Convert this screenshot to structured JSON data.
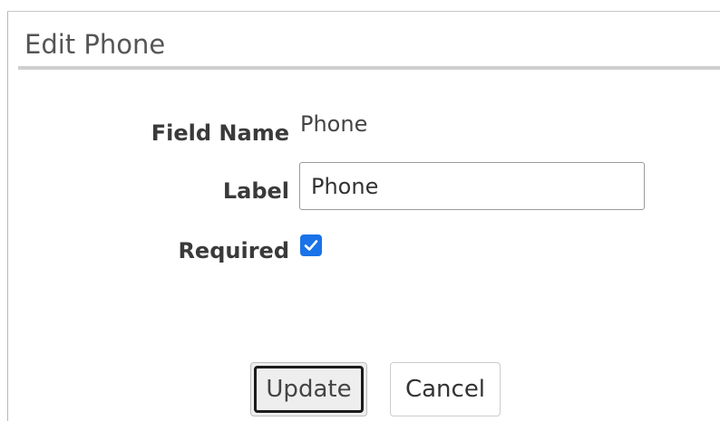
{
  "dialog": {
    "title": "Edit Phone"
  },
  "form": {
    "field_name_label": "Field Name",
    "field_name_value": "Phone",
    "label_label": "Label",
    "label_value": "Phone",
    "required_label": "Required",
    "required_checked": true
  },
  "buttons": {
    "update_label": "Update",
    "cancel_label": "Cancel"
  },
  "colors": {
    "checkbox_accent": "#1a73e8",
    "update_focus_ring": "#1c1c1c"
  }
}
